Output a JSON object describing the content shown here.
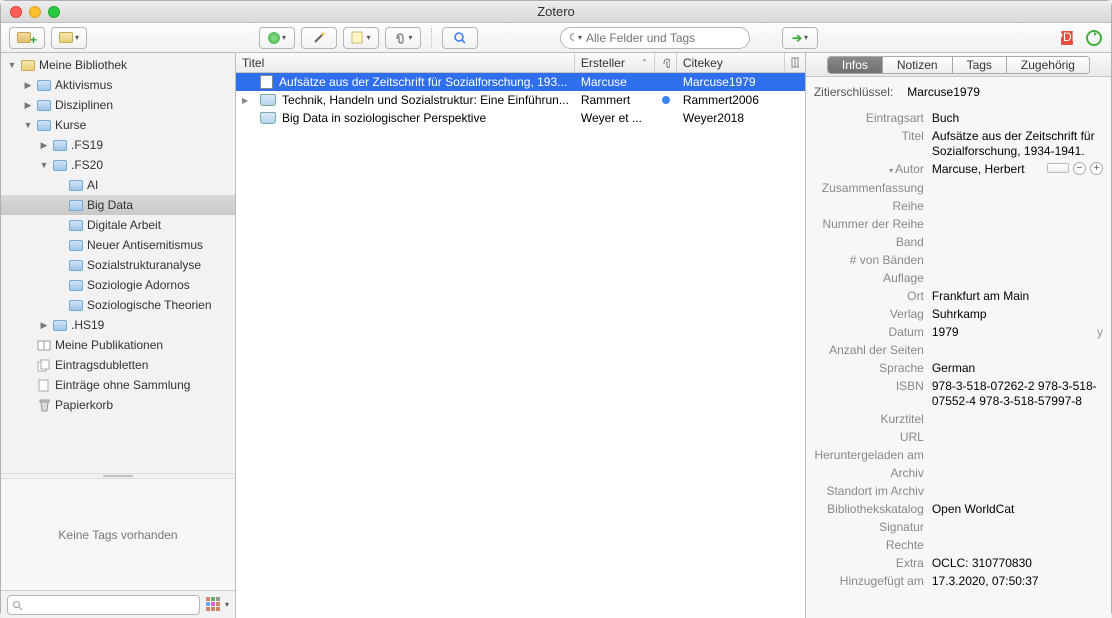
{
  "window": {
    "title": "Zotero"
  },
  "toolbar": {
    "search_placeholder": "Alle Felder und Tags"
  },
  "sidebar": {
    "items": [
      {
        "label": "Meine Bibliothek",
        "indent": 0,
        "icon": "library",
        "disclose": "down"
      },
      {
        "label": "Aktivismus",
        "indent": 1,
        "icon": "folder",
        "disclose": "right"
      },
      {
        "label": "Disziplinen",
        "indent": 1,
        "icon": "folder",
        "disclose": "right"
      },
      {
        "label": "Kurse",
        "indent": 1,
        "icon": "folder",
        "disclose": "down"
      },
      {
        "label": ".FS19",
        "indent": 2,
        "icon": "folder",
        "disclose": "right"
      },
      {
        "label": ".FS20",
        "indent": 2,
        "icon": "folder",
        "disclose": "down"
      },
      {
        "label": "AI",
        "indent": 3,
        "icon": "folder",
        "disclose": ""
      },
      {
        "label": "Big Data",
        "indent": 3,
        "icon": "folder",
        "disclose": "",
        "selected": true
      },
      {
        "label": "Digitale Arbeit",
        "indent": 3,
        "icon": "folder",
        "disclose": ""
      },
      {
        "label": "Neuer Antisemitismus",
        "indent": 3,
        "icon": "folder",
        "disclose": ""
      },
      {
        "label": "Sozialstrukturanalyse",
        "indent": 3,
        "icon": "folder",
        "disclose": ""
      },
      {
        "label": "Soziologie Adornos",
        "indent": 3,
        "icon": "folder",
        "disclose": ""
      },
      {
        "label": "Soziologische Theorien",
        "indent": 3,
        "icon": "folder",
        "disclose": ""
      },
      {
        "label": ".HS19",
        "indent": 2,
        "icon": "folder",
        "disclose": "right"
      },
      {
        "label": "Meine Publikationen",
        "indent": 1,
        "icon": "pub",
        "disclose": ""
      },
      {
        "label": "Eintragsdubletten",
        "indent": 1,
        "icon": "dup",
        "disclose": ""
      },
      {
        "label": "Einträge ohne Sammlung",
        "indent": 1,
        "icon": "unfiled",
        "disclose": ""
      },
      {
        "label": "Papierkorb",
        "indent": 1,
        "icon": "trash",
        "disclose": ""
      }
    ],
    "no_tags": "Keine Tags vorhanden"
  },
  "columns": {
    "title": "Titel",
    "creator": "Ersteller",
    "citekey": "Citekey"
  },
  "items": [
    {
      "title": "Aufsätze aus der Zeitschrift für Sozialforschung, 193...",
      "creator": "Marcuse",
      "citekey": "Marcuse1979",
      "type": "doc",
      "selected": true,
      "att": ""
    },
    {
      "title": "Technik, Handeln und Sozialstruktur: Eine Einführun...",
      "creator": "Rammert",
      "citekey": "Rammert2006",
      "type": "book",
      "disclose": "right",
      "att": "dot"
    },
    {
      "title": "Big Data in soziologischer Perspektive",
      "creator": "Weyer et ...",
      "citekey": "Weyer2018",
      "type": "book",
      "att": ""
    }
  ],
  "tabs": {
    "info": "Infos",
    "notes": "Notizen",
    "tags": "Tags",
    "related": "Zugehörig"
  },
  "detail": {
    "citekey_label": "Zitierschlüssel:",
    "citekey": "Marcuse1979",
    "f": {
      "type_k": "Eintragsart",
      "type_v": "Buch",
      "title_k": "Titel",
      "title_v": "Aufsätze aus der Zeitschrift für Sozialforschung, 1934-1941.",
      "author_k": "Autor",
      "author_v": "Marcuse, Herbert",
      "abstract_k": "Zusammenfassung",
      "abstract_v": "",
      "series_k": "Reihe",
      "series_v": "",
      "seriesno_k": "Nummer der Reihe",
      "seriesno_v": "",
      "volume_k": "Band",
      "volume_v": "",
      "numvol_k": "# von Bänden",
      "numvol_v": "",
      "edition_k": "Auflage",
      "edition_v": "",
      "place_k": "Ort",
      "place_v": "Frankfurt am Main",
      "publisher_k": "Verlag",
      "publisher_v": "Suhrkamp",
      "date_k": "Datum",
      "date_v": "1979",
      "date_flag": "y",
      "pages_k": "Anzahl der Seiten",
      "pages_v": "",
      "lang_k": "Sprache",
      "lang_v": "German",
      "isbn_k": "ISBN",
      "isbn_v": "978-3-518-07262-2 978-3-518-07552-4 978-3-518-57997-8",
      "short_k": "Kurztitel",
      "short_v": "",
      "url_k": "URL",
      "url_v": "",
      "accessed_k": "Heruntergeladen am",
      "accessed_v": "",
      "archive_k": "Archiv",
      "archive_v": "",
      "loc_k": "Standort im Archiv",
      "loc_v": "",
      "catalog_k": "Bibliothekskatalog",
      "catalog_v": "Open WorldCat",
      "call_k": "Signatur",
      "call_v": "",
      "rights_k": "Rechte",
      "rights_v": "",
      "extra_k": "Extra",
      "extra_v": "OCLC: 310770830",
      "added_k": "Hinzugefügt am",
      "added_v": "17.3.2020, 07:50:37"
    }
  }
}
